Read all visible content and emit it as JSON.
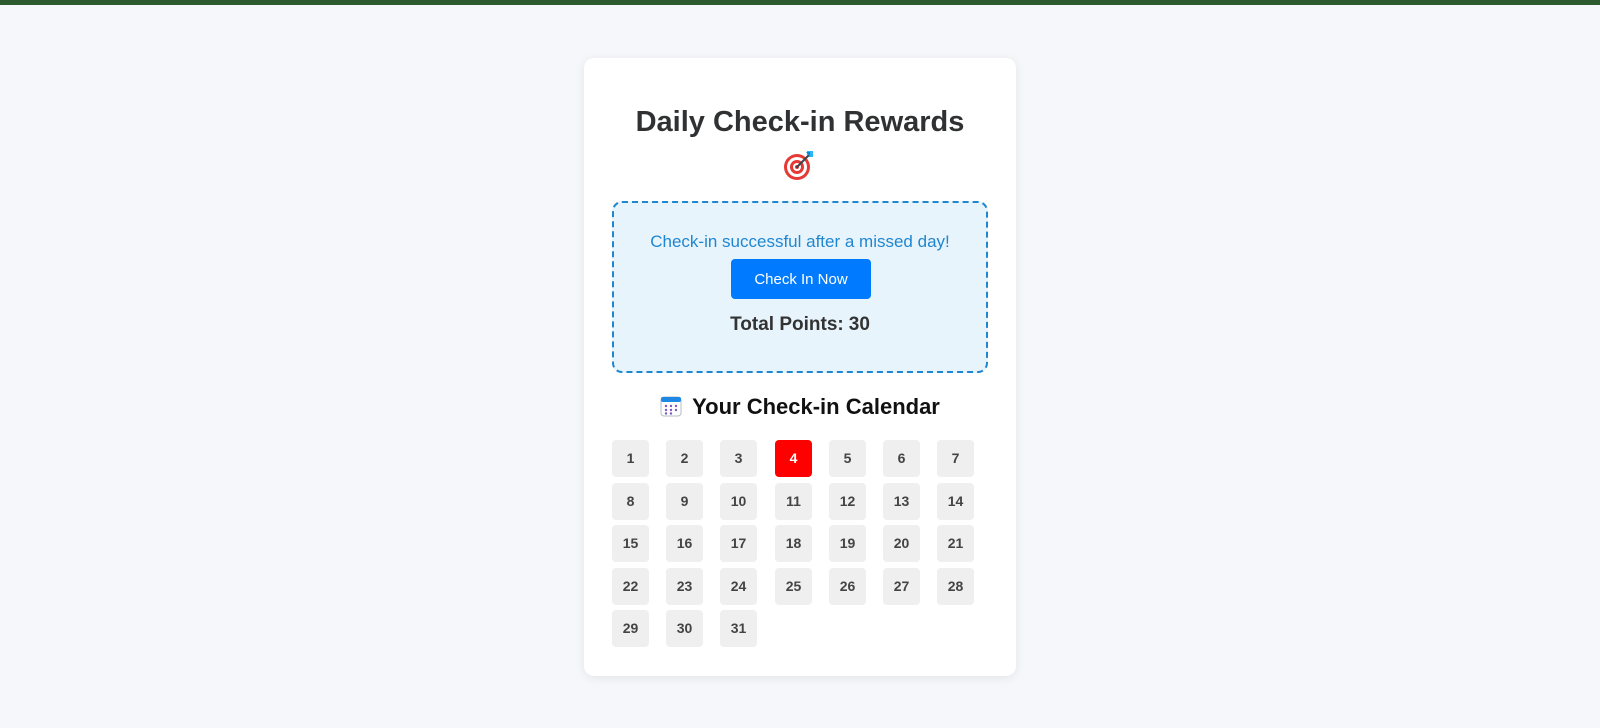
{
  "app": {
    "title": "Daily Check-in Rewards",
    "title_icon": "target-icon"
  },
  "status": {
    "message": "Check-in successful after a missed day!",
    "button_label": "Check In Now",
    "points_label": "Total Points:",
    "points_value": "30"
  },
  "calendar": {
    "title": "Your Check-in Calendar",
    "title_icon": "calendar-icon",
    "days": [
      "1",
      "2",
      "3",
      "4",
      "5",
      "6",
      "7",
      "8",
      "9",
      "10",
      "11",
      "12",
      "13",
      "14",
      "15",
      "16",
      "17",
      "18",
      "19",
      "20",
      "21",
      "22",
      "23",
      "24",
      "25",
      "26",
      "27",
      "28",
      "29",
      "30",
      "31"
    ],
    "highlighted_day": "4"
  },
  "colors": {
    "top_bar": "#2d5a2e",
    "accent": "#007bff",
    "status_border": "#1f86d0",
    "status_background": "#e8f4fc",
    "highlight_day": "#ff0000",
    "day_background": "#efefef"
  }
}
